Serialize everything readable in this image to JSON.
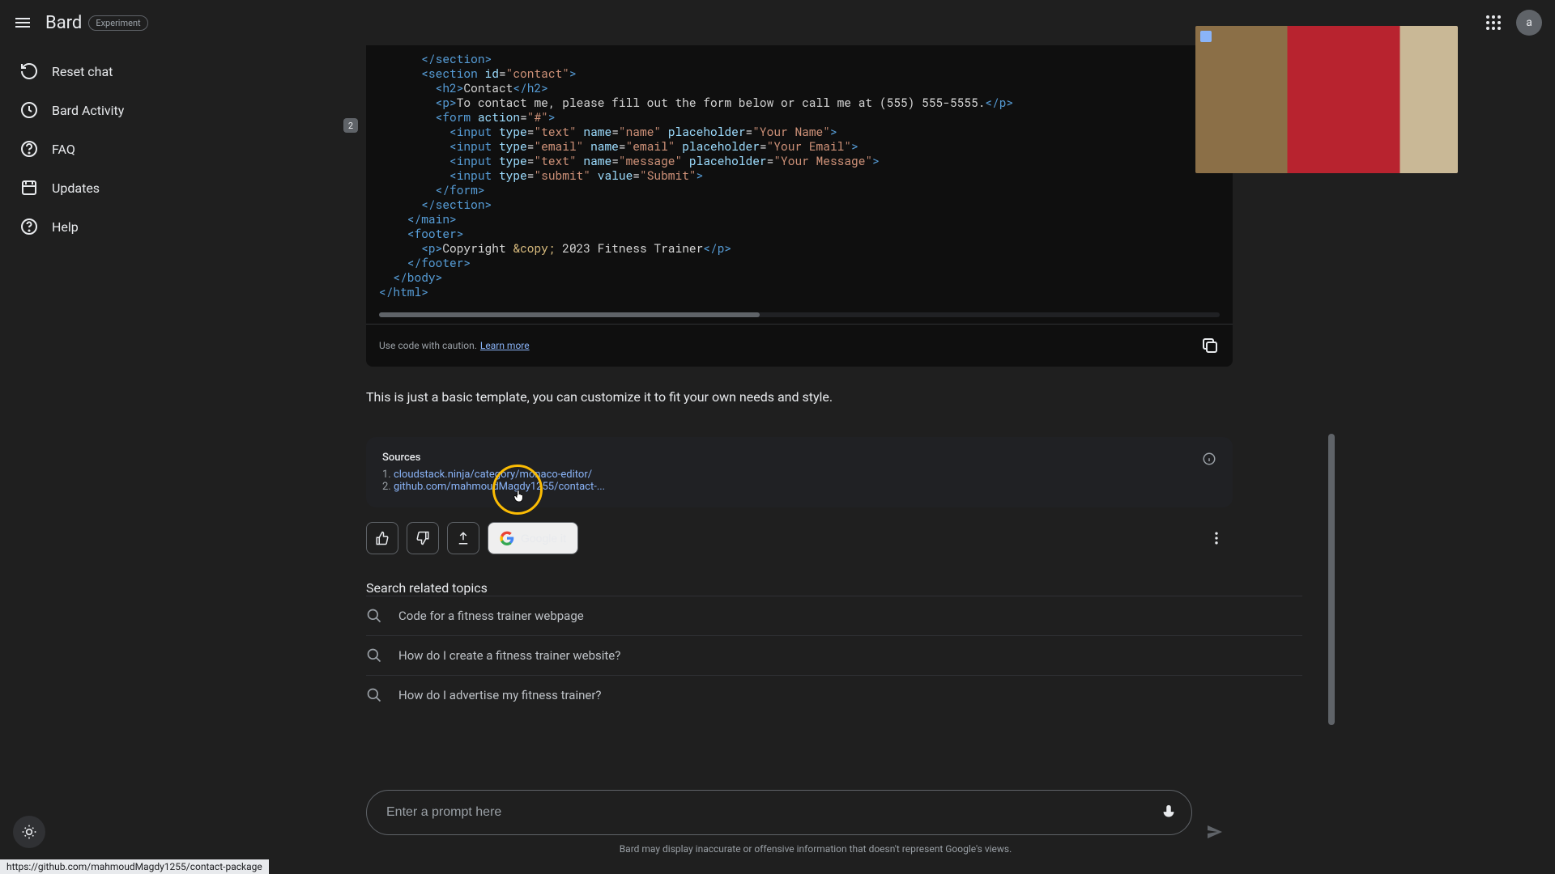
{
  "header": {
    "brand": "Bard",
    "badge": "Experiment",
    "avatar_letter": "a"
  },
  "sidebar": {
    "items": [
      {
        "label": "Reset chat"
      },
      {
        "label": "Bard Activity"
      },
      {
        "label": "FAQ"
      },
      {
        "label": "Updates"
      },
      {
        "label": "Help"
      }
    ]
  },
  "code": {
    "gutter_badge": "2",
    "caution": "Use code with caution.",
    "learn_more": "Learn more"
  },
  "response_text": "This is just a basic template, you can customize it to fit your own needs and style.",
  "sources": {
    "title": "Sources",
    "items": [
      {
        "num": "1.",
        "text": "cloudstack.ninja/category/monaco-editor/"
      },
      {
        "num": "2.",
        "text": "github.com/mahmoudMagdy1255/contact-..."
      }
    ]
  },
  "actions": {
    "google_it": "Google it"
  },
  "related": {
    "title": "Search related topics",
    "items": [
      "Code for a fitness trainer webpage",
      "How do I create a fitness trainer website?",
      "How do I advertise my fitness trainer?"
    ]
  },
  "input": {
    "placeholder": "Enter a prompt here",
    "disclaimer": "Bard may display inaccurate or offensive information that doesn't represent Google's views."
  },
  "status_url": "https://github.com/mahmoudMagdy1255/contact-package"
}
